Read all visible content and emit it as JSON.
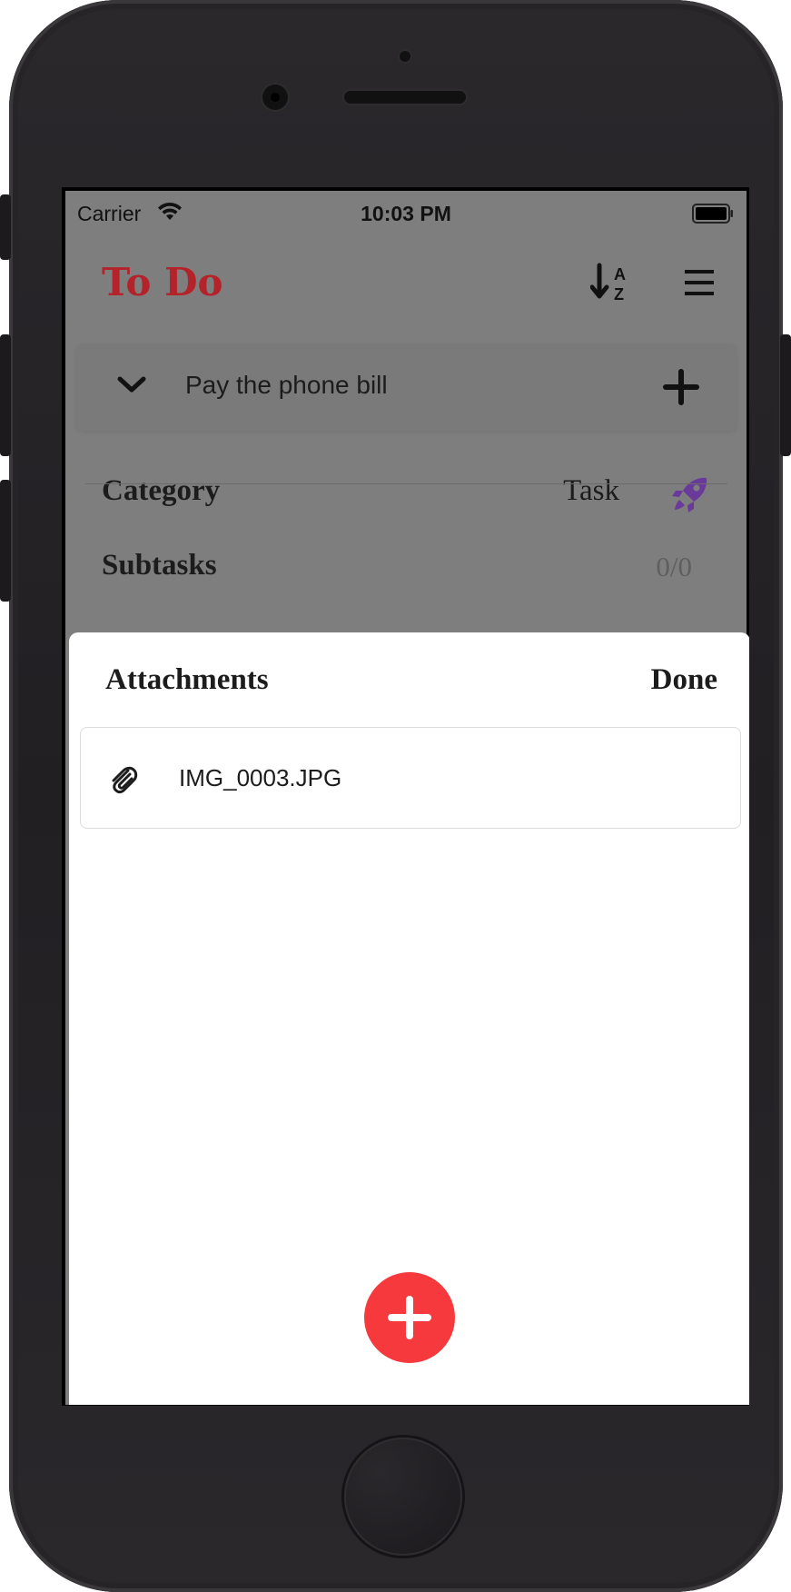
{
  "status_bar": {
    "carrier": "Carrier",
    "time": "10:03 PM"
  },
  "header": {
    "title": "To Do",
    "title_color": "#b4232a"
  },
  "task": {
    "name": "Pay the phone bill"
  },
  "category": {
    "label": "Category",
    "value": "Task",
    "icon": "rocket-icon",
    "icon_color": "#6a3a9a"
  },
  "subtasks": {
    "label": "Subtasks",
    "count": "0/0"
  },
  "sheet": {
    "title": "Attachments",
    "done_label": "Done",
    "attachments": [
      {
        "name": "IMG_0003.JPG",
        "icon": "paperclip-icon"
      }
    ],
    "add_button_color": "#f6393d"
  }
}
